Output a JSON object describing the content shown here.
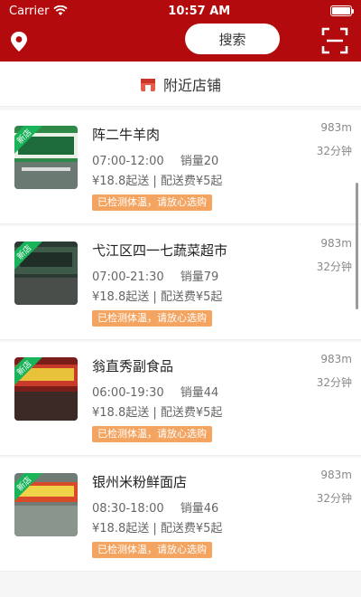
{
  "status": {
    "carrier": "Carrier",
    "time": "10:57 AM"
  },
  "navbar": {
    "search_label": "搜索"
  },
  "section": {
    "title": "附近店铺"
  },
  "stores": [
    {
      "name": "阵二牛羊肉",
      "hours": "07:00-12:00",
      "sales": "销量20",
      "fees": "¥18.8起送 | 配送费¥5起",
      "tag": "已检测体温，请放心选购",
      "distance": "983m",
      "eta": "32分钟",
      "badge": "新店"
    },
    {
      "name": "弋江区四一七蔬菜超市",
      "hours": "07:00-21:30",
      "sales": "销量79",
      "fees": "¥18.8起送 | 配送费¥5起",
      "tag": "已检测体温，请放心选购",
      "distance": "983m",
      "eta": "32分钟",
      "badge": "新店"
    },
    {
      "name": "翁直秀副食品",
      "hours": "06:00-19:30",
      "sales": "销量44",
      "fees": "¥18.8起送 | 配送费¥5起",
      "tag": "已检测体温，请放心选购",
      "distance": "983m",
      "eta": "32分钟",
      "badge": "新店"
    },
    {
      "name": "银州米粉鲜面店",
      "hours": "08:30-18:00",
      "sales": "销量46",
      "fees": "¥18.8起送 | 配送费¥5起",
      "tag": "已检测体温，请放心选购",
      "distance": "983m",
      "eta": "32分钟",
      "badge": "新店"
    }
  ],
  "colors": {
    "brand": "#b20a0d",
    "tag_bg": "#f4a461",
    "badge_bg": "#19b35a"
  },
  "icons": {
    "location": "location-pin-icon",
    "scan": "scan-icon",
    "shop": "shop-icon",
    "wifi": "wifi-icon",
    "battery": "battery-icon"
  }
}
